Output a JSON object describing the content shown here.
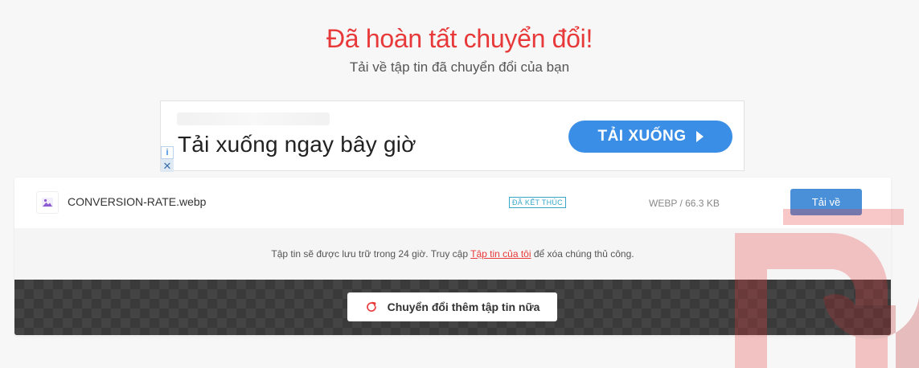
{
  "header": {
    "title": "Đã hoàn tất chuyển đổi!",
    "subtitle": "Tải về tập tin đã chuyển đổi của bạn"
  },
  "ad": {
    "headline": "Tải xuống ngay bây giờ",
    "cta_label": "TẢI XUỐNG",
    "info_glyph": "i",
    "close_glyph": "✕"
  },
  "file": {
    "icon": "image-file-icon",
    "name": "CONVERSION-RATE.webp",
    "status": "ĐÃ KẾT THÚC",
    "meta": "WEBP / 66.3 KB",
    "download_label": "Tải về"
  },
  "notice": {
    "before": "Tập tin sẽ được lưu trữ trong 24 giờ. Truy cập ",
    "link": "Tập tin của tôi",
    "after": " để xóa chúng thủ công."
  },
  "actions": {
    "convert_more_label": "Chuyển đổi thêm tập tin nữa",
    "convert_more_icon": "refresh-icon"
  },
  "colors": {
    "accent_red": "#e8393a",
    "button_blue": "#4a90d9",
    "ad_blue": "#3a8ee6",
    "badge_teal": "#3aa6c9"
  }
}
